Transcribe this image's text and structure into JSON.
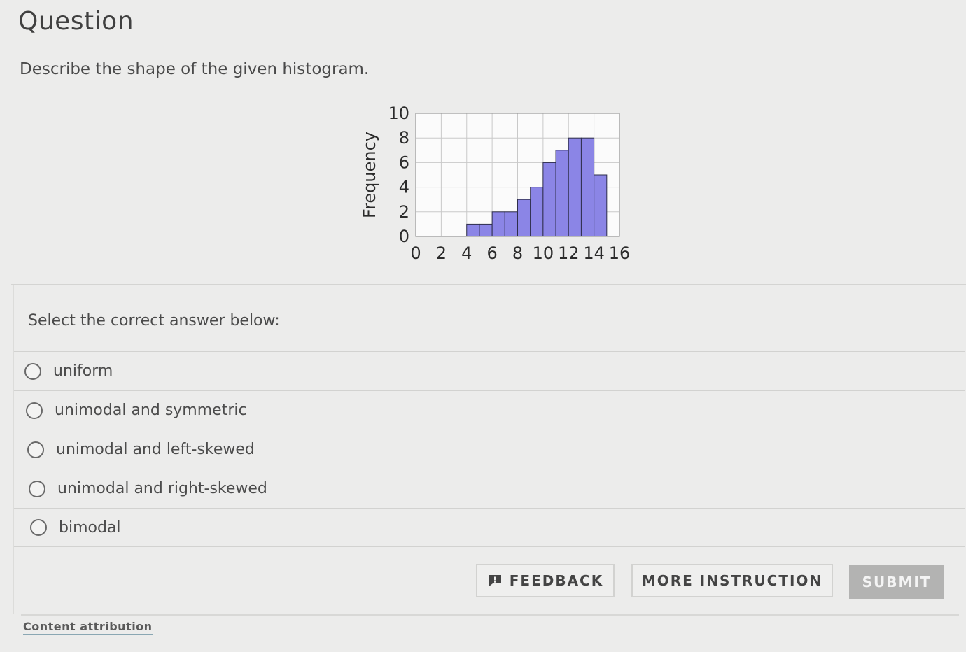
{
  "page": {
    "title": "Question",
    "prompt": "Describe the shape of the given histogram."
  },
  "answers": {
    "select_label": "Select the correct answer below:",
    "options": [
      {
        "label": "uniform",
        "selected": false
      },
      {
        "label": "unimodal and symmetric",
        "selected": false
      },
      {
        "label": "unimodal and left-skewed",
        "selected": false
      },
      {
        "label": "unimodal and right-skewed",
        "selected": false
      },
      {
        "label": "bimodal",
        "selected": false
      }
    ]
  },
  "actions": {
    "feedback_label": "FEEDBACK",
    "feedback_icon": "feedback-icon",
    "more_instruction_label": "MORE INSTRUCTION",
    "submit_label": "SUBMIT"
  },
  "footer": {
    "attribution_label": "Content attribution"
  },
  "chart_data": {
    "type": "bar",
    "bin_edges": [
      0,
      1,
      2,
      3,
      4,
      5,
      6,
      7,
      8,
      9,
      10,
      11,
      12,
      13,
      14,
      15,
      16
    ],
    "values": [
      0,
      0,
      0,
      0,
      1,
      1,
      2,
      2,
      3,
      4,
      6,
      7,
      8,
      8,
      5,
      0
    ],
    "xticks": [
      0,
      2,
      4,
      6,
      8,
      10,
      12,
      14,
      16
    ],
    "yticks": [
      0,
      2,
      4,
      6,
      8,
      10
    ],
    "xlim": [
      0,
      16
    ],
    "ylim": [
      0,
      10
    ],
    "ylabel": "Frequency",
    "xlabel": "",
    "grid": true,
    "bar_color": "#8b85e6",
    "bar_edge_color": "#2e2e4a"
  }
}
